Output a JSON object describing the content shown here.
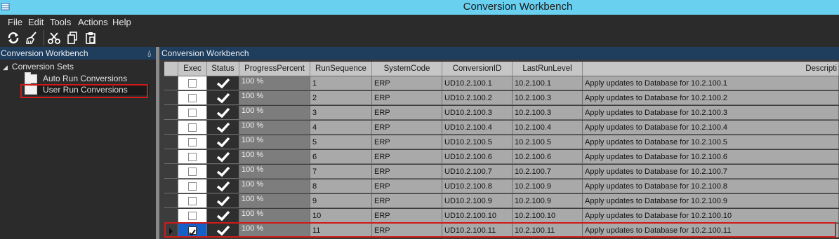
{
  "window": {
    "title": "Conversion Workbench"
  },
  "menu": [
    "File",
    "Edit",
    "Tools",
    "Actions",
    "Help"
  ],
  "toolbar": {
    "icons": [
      "refresh-icon",
      "clear-icon",
      "cut-icon",
      "copy-icon",
      "paste-icon"
    ]
  },
  "left_panel": {
    "title": "Conversion Workbench",
    "pin_label": "⍙",
    "tree": {
      "root": "Conversion Sets",
      "children": [
        "Auto Run Conversions",
        "User Run Conversions"
      ]
    }
  },
  "right_panel": {
    "title": "Conversion Workbench",
    "columns": [
      "Exec",
      "Status",
      "ProgressPercent",
      "RunSequence",
      "SystemCode",
      "ConversionID",
      "LastRunLevel",
      "Descripti"
    ],
    "rows": [
      {
        "exec": false,
        "progress": "100 %",
        "seq": "1",
        "sys": "ERP",
        "conv": "UD10.2.100.1",
        "last": "10.2.100.1",
        "desc": "Apply updates to Database for 10.2.100.1"
      },
      {
        "exec": false,
        "progress": "100 %",
        "seq": "2",
        "sys": "ERP",
        "conv": "UD10.2.100.2",
        "last": "10.2.100.3",
        "desc": "Apply updates to Database for 10.2.100.2"
      },
      {
        "exec": false,
        "progress": "100 %",
        "seq": "3",
        "sys": "ERP",
        "conv": "UD10.2.100.3",
        "last": "10.2.100.3",
        "desc": "Apply updates to Database for 10.2.100.3"
      },
      {
        "exec": false,
        "progress": "100 %",
        "seq": "4",
        "sys": "ERP",
        "conv": "UD10.2.100.4",
        "last": "10.2.100.4",
        "desc": "Apply updates to Database for 10.2.100.4"
      },
      {
        "exec": false,
        "progress": "100 %",
        "seq": "5",
        "sys": "ERP",
        "conv": "UD10.2.100.5",
        "last": "10.2.100.5",
        "desc": "Apply updates to Database for 10.2.100.5"
      },
      {
        "exec": false,
        "progress": "100 %",
        "seq": "6",
        "sys": "ERP",
        "conv": "UD10.2.100.6",
        "last": "10.2.100.6",
        "desc": "Apply updates to Database for 10.2.100.6"
      },
      {
        "exec": false,
        "progress": "100 %",
        "seq": "7",
        "sys": "ERP",
        "conv": "UD10.2.100.7",
        "last": "10.2.100.7",
        "desc": "Apply updates to Database for 10.2.100.7"
      },
      {
        "exec": false,
        "progress": "100 %",
        "seq": "8",
        "sys": "ERP",
        "conv": "UD10.2.100.8",
        "last": "10.2.100.9",
        "desc": "Apply updates to Database for 10.2.100.8"
      },
      {
        "exec": false,
        "progress": "100 %",
        "seq": "9",
        "sys": "ERP",
        "conv": "UD10.2.100.9",
        "last": "10.2.100.9",
        "desc": "Apply updates to Database for 10.2.100.9"
      },
      {
        "exec": false,
        "progress": "100 %",
        "seq": "10",
        "sys": "ERP",
        "conv": "UD10.2.100.10",
        "last": "10.2.100.10",
        "desc": "Apply updates to Database for 10.2.100.10"
      },
      {
        "exec": true,
        "progress": "100 %",
        "seq": "11",
        "sys": "ERP",
        "conv": "UD10.2.100.11",
        "last": "10.2.100.11",
        "desc": "Apply updates to Database for 10.2.100.11"
      }
    ]
  },
  "colors": {
    "title_bar": "#6ad0f0",
    "panel_header": "#1f3d5c",
    "highlight": "#d01a1a"
  }
}
